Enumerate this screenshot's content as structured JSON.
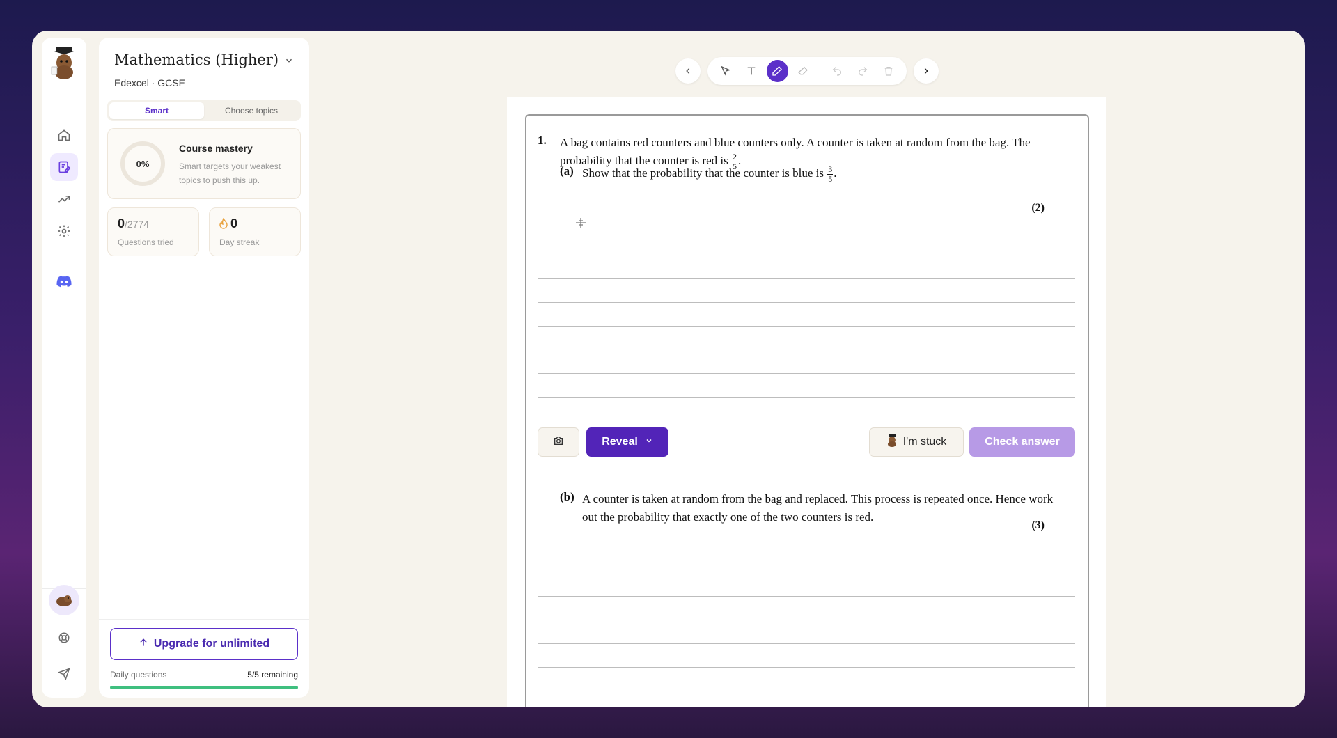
{
  "course": {
    "title": "Mathematics (Higher)",
    "subtitle": "Edexcel · GCSE"
  },
  "modes": {
    "smart": "Smart",
    "choose": "Choose topics"
  },
  "mastery": {
    "percent": "0%",
    "title": "Course mastery",
    "description": "Smart targets your weakest topics to push this up."
  },
  "stats": {
    "questions_value": "0",
    "questions_total": "/2774",
    "questions_label": "Questions tried",
    "streak_value": "0",
    "streak_label": "Day streak"
  },
  "upgrade": {
    "label": "Upgrade for unlimited"
  },
  "daily": {
    "label": "Daily questions",
    "remaining": "5/5 remaining",
    "fill_fraction": 1.0
  },
  "question": {
    "number": "1.",
    "stem_1": "A bag contains red counters and blue counters only. A counter is taken at random from the bag. The probability that the counter is red is",
    "red_num": "2",
    "red_den": "5",
    "stem_end": ".",
    "part_a": {
      "label": "(a)",
      "text": "Show that the probability that the counter is blue is",
      "num": "3",
      "den": "5",
      "end": ".",
      "marks": "(2)"
    },
    "part_b": {
      "label": "(b)",
      "text": "A counter is taken at random from the bag and replaced. This process is repeated once. Hence work out the probability that exactly one of the two counters is red.",
      "marks": "(3)"
    }
  },
  "actions": {
    "reveal": "Reveal",
    "stuck": "I'm stuck",
    "check": "Check answer"
  },
  "colors": {
    "accent": "#5224b8",
    "check_disabled": "#b79ae6",
    "progress": "#3fbf7f"
  }
}
